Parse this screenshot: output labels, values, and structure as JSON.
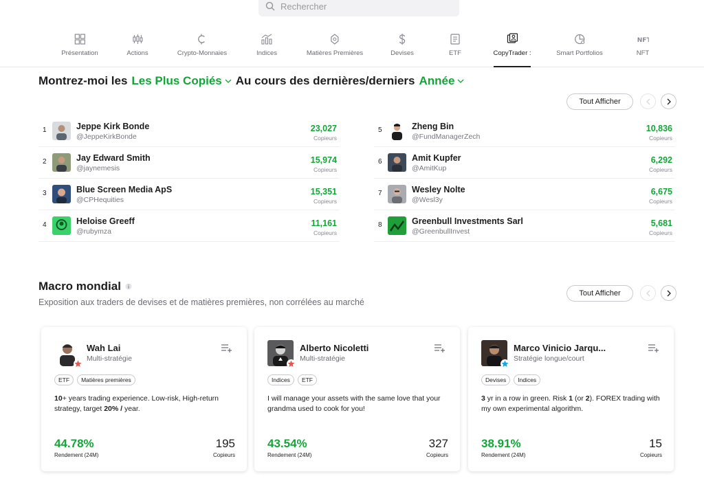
{
  "search": {
    "placeholder": "Rechercher"
  },
  "nav": [
    {
      "label": "Présentation",
      "icon": "grid-icon"
    },
    {
      "label": "Actions",
      "icon": "candlestick-icon"
    },
    {
      "label": "Crypto-Monnaies",
      "icon": "crypto-icon"
    },
    {
      "label": "Indices",
      "icon": "bar-chart-icon"
    },
    {
      "label": "Matières Premières",
      "icon": "commodity-icon"
    },
    {
      "label": "Devises",
      "icon": "dollar-icon"
    },
    {
      "label": "ETF",
      "icon": "document-icon"
    },
    {
      "label": "CopyTrader :",
      "icon": "copytrader-icon",
      "active": true
    },
    {
      "label": "Smart Portfolios",
      "icon": "pie-chart-icon"
    },
    {
      "label": "NFT",
      "icon": "nft-icon"
    }
  ],
  "top_section": {
    "prefix": "Montrez-moi les",
    "filter_1": "Les Plus Copiés",
    "middle": "Au cours des dernières/derniers",
    "filter_2": "Année",
    "show_all": "Tout Afficher"
  },
  "traders": [
    {
      "rank": "1",
      "name": "Jeppe Kirk Bonde",
      "handle": "@JeppeKirkBonde",
      "copiers": "23,027",
      "copiers_label": "Copieurs",
      "avatar_color": "#9aa3ab"
    },
    {
      "rank": "2",
      "name": "Jay Edward Smith",
      "handle": "@jaynemesis",
      "copiers": "15,974",
      "copiers_label": "Copieurs",
      "avatar_color": "#7d8a6c"
    },
    {
      "rank": "3",
      "name": "Blue Screen Media ApS",
      "handle": "@CPHequities",
      "copiers": "15,351",
      "copiers_label": "Copieurs",
      "avatar_color": "#3b6fb0"
    },
    {
      "rank": "4",
      "name": "Heloise Greeff",
      "handle": "@rubymza",
      "copiers": "11,161",
      "copiers_label": "Copieurs",
      "avatar_color": "#2fbf5b"
    },
    {
      "rank": "5",
      "name": "Zheng Bin",
      "handle": "@FundManagerZech",
      "copiers": "10,836",
      "copiers_label": "Copieurs",
      "avatar_color": "#2a2a2e"
    },
    {
      "rank": "6",
      "name": "Amit Kupfer",
      "handle": "@AmitKup",
      "copiers": "6,292",
      "copiers_label": "Copieurs",
      "avatar_color": "#4a5566"
    },
    {
      "rank": "7",
      "name": "Wesley Nolte",
      "handle": "@Wesl3y",
      "copiers": "6,675",
      "copiers_label": "Copieurs",
      "avatar_color": "#8e8e93"
    },
    {
      "rank": "8",
      "name": "Greenbull Investments Sarl",
      "handle": "@GreenbullInvest",
      "copiers": "5,681",
      "copiers_label": "Copieurs",
      "avatar_color": "#1f9e3a"
    }
  ],
  "macro": {
    "title": "Macro mondial",
    "subtitle": "Exposition aux traders de devises et de matières premières, non corrélées au marché",
    "show_all": "Tout Afficher",
    "cards": [
      {
        "name": "Wah Lai",
        "strategy": "Multi-stratégie",
        "tags": [
          "ETF",
          "Matières premières"
        ],
        "desc_bold_1": "10",
        "desc_1": "+ years trading experience. Low-risk, High-return strategy, target ",
        "desc_bold_2": "20%",
        "desc_2": " ",
        "desc_bold_3": "/",
        "desc_3": " year.",
        "gain": "44.78%",
        "gain_label": "Rendement (24M)",
        "copiers": "195",
        "copiers_label": "Copieurs",
        "star_color": "#e8564f",
        "avatar_color": "#5b4a3f"
      },
      {
        "name": "Alberto Nicoletti",
        "strategy": "Multi-stratégie",
        "tags": [
          "Indices",
          "ETF"
        ],
        "desc_1": "I will manage your assets with the same love that your grandma used to cook for you!",
        "gain": "43.54%",
        "gain_label": "Rendement (24M)",
        "copiers": "327",
        "copiers_label": "Copieurs",
        "star_color": "#e8564f",
        "avatar_color": "#3a3a3c"
      },
      {
        "name": "Marco Vinicio Jarqu...",
        "strategy": "Stratégie longue/court",
        "tags": [
          "Devises",
          "Indices"
        ],
        "desc_bold_1": "3",
        "desc_1": " yr in a row in green. Risk ",
        "desc_bold_2": "1",
        "desc_2": " (or ",
        "desc_bold_3": "2",
        "desc_3": "). FOREX trading with my own experimental algorithm.",
        "gain": "38.91%",
        "gain_label": "Rendement (24M)",
        "copiers": "15",
        "copiers_label": "Copieurs",
        "star_color": "#1aa3e8",
        "avatar_color": "#2e2a28"
      }
    ]
  }
}
